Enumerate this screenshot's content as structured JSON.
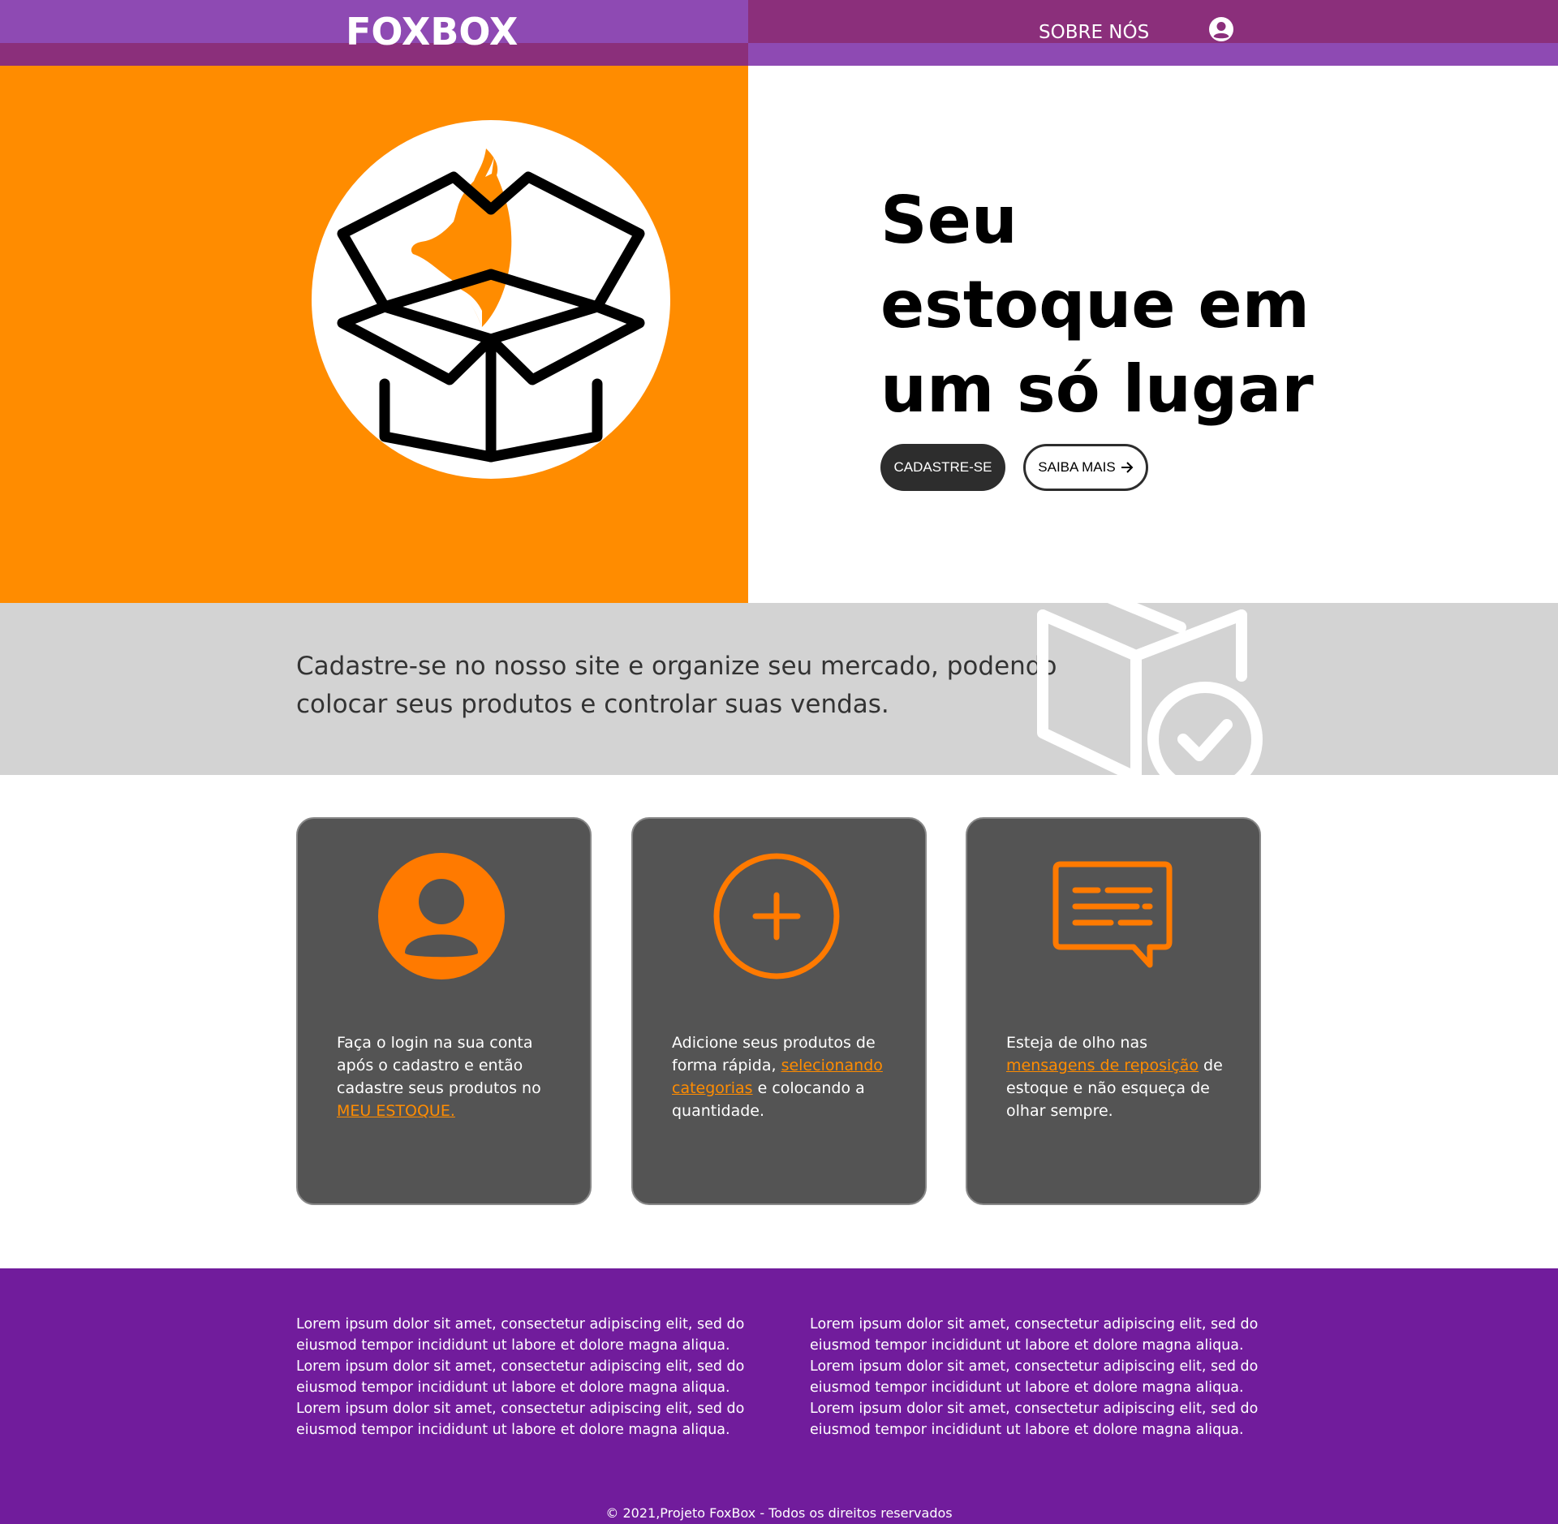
{
  "header": {
    "logo": "FOXBOX",
    "nav_about": "SOBRE NÓS",
    "user_icon": "user-circle-icon"
  },
  "hero": {
    "title": "Seu estoque em um só lugar",
    "signup_label": "CADASTRE-SE",
    "more_label": "SAIBA MAIS",
    "more_icon": "arrow-right-icon",
    "illustration": "fox-in-box-icon"
  },
  "band": {
    "text": "Cadastre-se no nosso site e organize seu mercado, podendo colocar seus produtos e controlar suas vendas.",
    "icon": "box-check-icon"
  },
  "cards": [
    {
      "icon": "user-circle-icon",
      "text_before": "Faça o login na sua conta após o cadastro e então cadastre seus produtos no ",
      "link": "MEU ESTOQUE.",
      "text_after": ""
    },
    {
      "icon": "plus-circle-icon",
      "text_before": "Adicione seus produtos de forma rápida, ",
      "link": "selecionando categorias",
      "text_after": " e colocando a quantidade."
    },
    {
      "icon": "message-icon",
      "text_before": "Esteja de olho nas ",
      "link": "mensagens de reposição",
      "text_after": " de estoque e não esqueça de olhar sempre."
    }
  ],
  "footer": {
    "col1": "Lorem ipsum dolor sit amet, consectetur adipiscing elit, sed do eiusmod tempor incididunt ut labore et dolore magna aliqua. Lorem ipsum dolor sit amet, consectetur adipiscing elit, sed do eiusmod tempor incididunt ut labore et dolore magna aliqua. Lorem ipsum dolor sit amet, consectetur adipiscing elit, sed do eiusmod tempor incididunt ut labore et dolore magna aliqua.",
    "col2": "Lorem ipsum dolor sit amet, consectetur adipiscing elit, sed do eiusmod tempor incididunt ut labore et dolore magna aliqua. Lorem ipsum dolor sit amet, consectetur adipiscing elit, sed do eiusmod tempor incididunt ut labore et dolore magna aliqua. Lorem ipsum dolor sit amet, consectetur adipiscing elit, sed do eiusmod tempor incididunt ut labore et dolore magna aliqua.",
    "copyright": "© 2021,Projeto FoxBox - Todos os direitos reservados"
  },
  "colors": {
    "orange": "#ff8c00",
    "purple_light": "#8e4ab3",
    "purple_dark": "#8b2f7b",
    "footer_purple": "#711c9c",
    "card_gray": "#545454",
    "band_gray": "#d3d3d3"
  }
}
